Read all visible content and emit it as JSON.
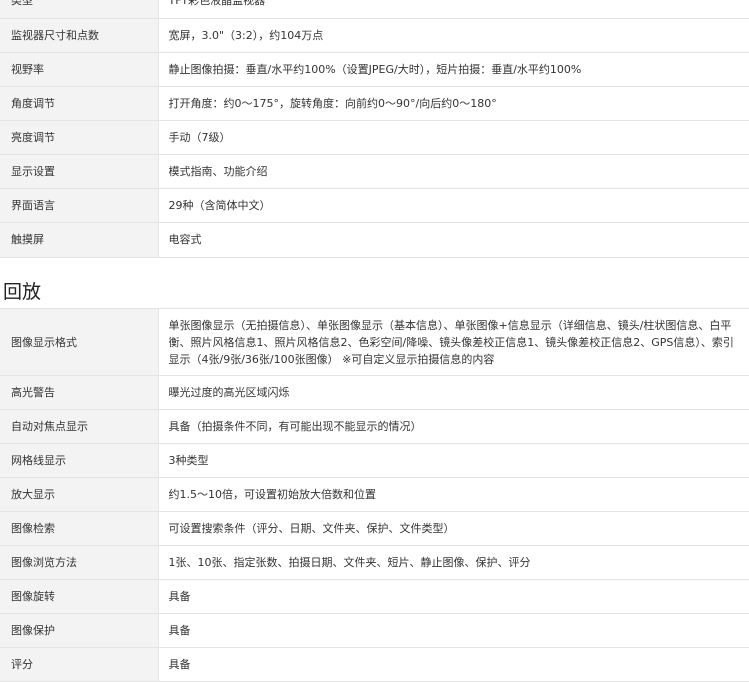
{
  "display_specs": [
    {
      "label": "类型",
      "value": "TFT彩色液晶监视器"
    },
    {
      "label": "监视器尺寸和点数",
      "value": "宽屏，3.0\"（3:2），约104万点"
    },
    {
      "label": "视野率",
      "value": "静止图像拍摄：垂直/水平约100%（设置JPEG/大时），短片拍摄：垂直/水平约100%"
    },
    {
      "label": "角度调节",
      "value": "打开角度：约0～175°，旋转角度：向前约0～90°/向后约0～180°"
    },
    {
      "label": "亮度调节",
      "value": "手动（7级）"
    },
    {
      "label": "显示设置",
      "value": "模式指南、功能介绍"
    },
    {
      "label": "界面语言",
      "value": "29种（含简体中文）"
    },
    {
      "label": "触摸屏",
      "value": "电容式"
    }
  ],
  "playback": {
    "heading": "回放",
    "rows": [
      {
        "label": "图像显示格式",
        "value": "单张图像显示（无拍摄信息）、单张图像显示（基本信息）、单张图像+信息显示（详细信息、镜头/柱状图信息、白平衡、照片风格信息1、照片风格信息2、色彩空间/降噪、镜头像差校正信息1、镜头像差校正信息2、GPS信息）、索引显示（4张/9张/36张/100张图像） ※可自定义显示拍摄信息的内容"
      },
      {
        "label": "高光警告",
        "value": "曝光过度的高光区域闪烁"
      },
      {
        "label": "自动对焦点显示",
        "value": "具备（拍摄条件不同，有可能出现不能显示的情况）"
      },
      {
        "label": "网格线显示",
        "value": "3种类型"
      },
      {
        "label": "放大显示",
        "value": "约1.5～10倍，可设置初始放大倍数和位置"
      },
      {
        "label": "图像检索",
        "value": "可设置搜索条件（评分、日期、文件夹、保护、文件类型）"
      },
      {
        "label": "图像浏览方法",
        "value": "1张、10张、指定张数、拍摄日期、文件夹、短片、静止图像、保护、评分"
      },
      {
        "label": "图像旋转",
        "value": "具备"
      },
      {
        "label": "图像保护",
        "value": "具备"
      },
      {
        "label": "评分",
        "value": "具备"
      }
    ]
  }
}
